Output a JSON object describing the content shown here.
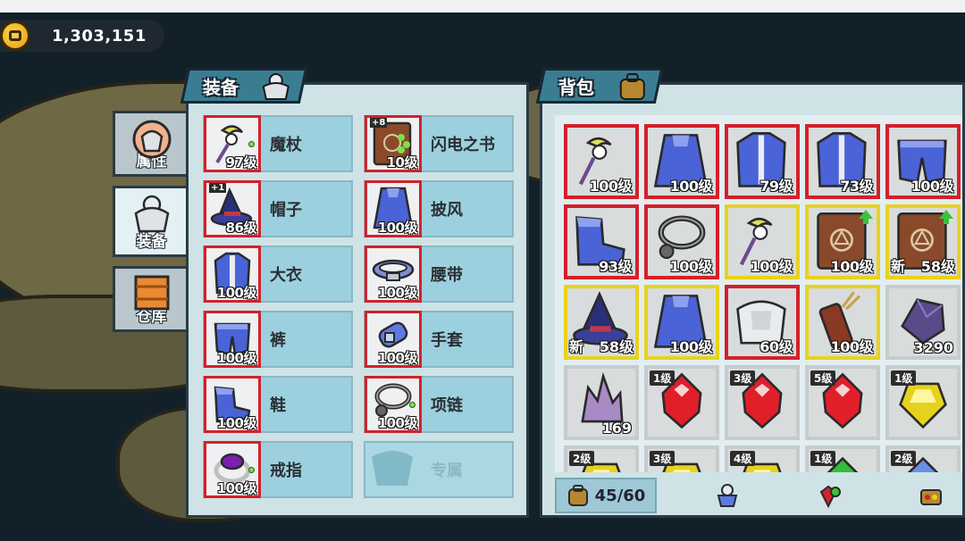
{
  "currency": {
    "amount": "1,303,151",
    "icon": "coin-icon"
  },
  "side_tabs": [
    {
      "label": "属性",
      "icon": "armor-attribute-icon",
      "active": false
    },
    {
      "label": "装备",
      "icon": "armor-icon",
      "active": true
    },
    {
      "label": "仓库",
      "icon": "crate-icon",
      "active": false
    }
  ],
  "equip_panel": {
    "title": "装备",
    "slots": [
      {
        "name": "魔杖",
        "level": "97级",
        "icon": "wand-icon"
      },
      {
        "name": "闪电之书",
        "level": "10级",
        "icon": "book-icon",
        "plus": "+8"
      },
      {
        "name": "帽子",
        "level": "86级",
        "icon": "wizard-hat-icon",
        "plus": "+1"
      },
      {
        "name": "披风",
        "level": "100级",
        "icon": "cape-icon"
      },
      {
        "name": "大衣",
        "level": "100级",
        "icon": "coat-icon"
      },
      {
        "name": "腰带",
        "level": "100级",
        "icon": "belt-icon"
      },
      {
        "name": "裤",
        "level": "100级",
        "icon": "pants-icon"
      },
      {
        "name": "手套",
        "level": "100级",
        "icon": "glove-icon"
      },
      {
        "name": "鞋",
        "level": "100级",
        "icon": "boots-icon"
      },
      {
        "name": "项链",
        "level": "100级",
        "icon": "necklace-icon"
      },
      {
        "name": "戒指",
        "level": "100级",
        "icon": "ring-icon"
      },
      {
        "name": "专属",
        "level": "",
        "icon": "exclusive-slot-icon",
        "empty": true
      }
    ]
  },
  "bag_panel": {
    "title": "背包",
    "items": [
      {
        "icon": "wand-icon",
        "label": "100级",
        "rarity": "red"
      },
      {
        "icon": "cape-icon",
        "label": "100级",
        "rarity": "red"
      },
      {
        "icon": "coat-icon",
        "label": "79级",
        "rarity": "red"
      },
      {
        "icon": "coat-icon",
        "label": "73级",
        "rarity": "red"
      },
      {
        "icon": "pants-icon",
        "label": "100级",
        "rarity": "red"
      },
      {
        "icon": "boots-icon",
        "label": "93级",
        "rarity": "red"
      },
      {
        "icon": "necklace-icon",
        "label": "100级",
        "rarity": "red"
      },
      {
        "icon": "wand-icon",
        "label": "100级",
        "rarity": "yellow"
      },
      {
        "icon": "book-icon",
        "label": "100级",
        "rarity": "yellow",
        "upgrade": true
      },
      {
        "icon": "book-icon",
        "label": "58级",
        "new": "新",
        "rarity": "yellow",
        "upgrade": true
      },
      {
        "icon": "wizard-hat-icon",
        "label": "58级",
        "new": "新",
        "rarity": "yellow"
      },
      {
        "icon": "cape-icon",
        "label": "100级",
        "rarity": "yellow"
      },
      {
        "icon": "armor-white-icon",
        "label": "60级",
        "rarity": "red"
      },
      {
        "icon": "quiver-icon",
        "label": "100级",
        "rarity": "yellow"
      },
      {
        "icon": "ore-icon",
        "count": "3290",
        "rarity": "gray"
      },
      {
        "icon": "crystal-icon",
        "count": "169",
        "rarity": "gray"
      },
      {
        "icon": "red-gem-icon",
        "gem_level": "1级",
        "rarity": "gray"
      },
      {
        "icon": "red-gem-icon",
        "gem_level": "3级",
        "rarity": "gray"
      },
      {
        "icon": "red-gem-icon",
        "gem_level": "5级",
        "rarity": "gray"
      },
      {
        "icon": "yellow-gem-icon",
        "gem_level": "1级",
        "rarity": "gray"
      },
      {
        "icon": "yellow-gem-icon",
        "gem_level": "2级",
        "rarity": "gray"
      },
      {
        "icon": "yellow-gem-icon",
        "gem_level": "3级",
        "rarity": "gray"
      },
      {
        "icon": "yellow-gem-icon",
        "gem_level": "4级",
        "rarity": "gray"
      },
      {
        "icon": "green-gem-icon",
        "gem_level": "1级",
        "rarity": "gray"
      },
      {
        "icon": "blue-gem-icon",
        "gem_level": "2级",
        "rarity": "gray"
      }
    ],
    "capacity": "45/60",
    "bottom_buttons": [
      "equip-filter-icon",
      "gem-filter-icon",
      "misc-filter-icon"
    ]
  },
  "colors": {
    "rarity_red": "#d4202a",
    "rarity_yellow": "#e9d21c",
    "title_bar": "#3a7d93",
    "panel_bg": "#cfe3e7"
  }
}
